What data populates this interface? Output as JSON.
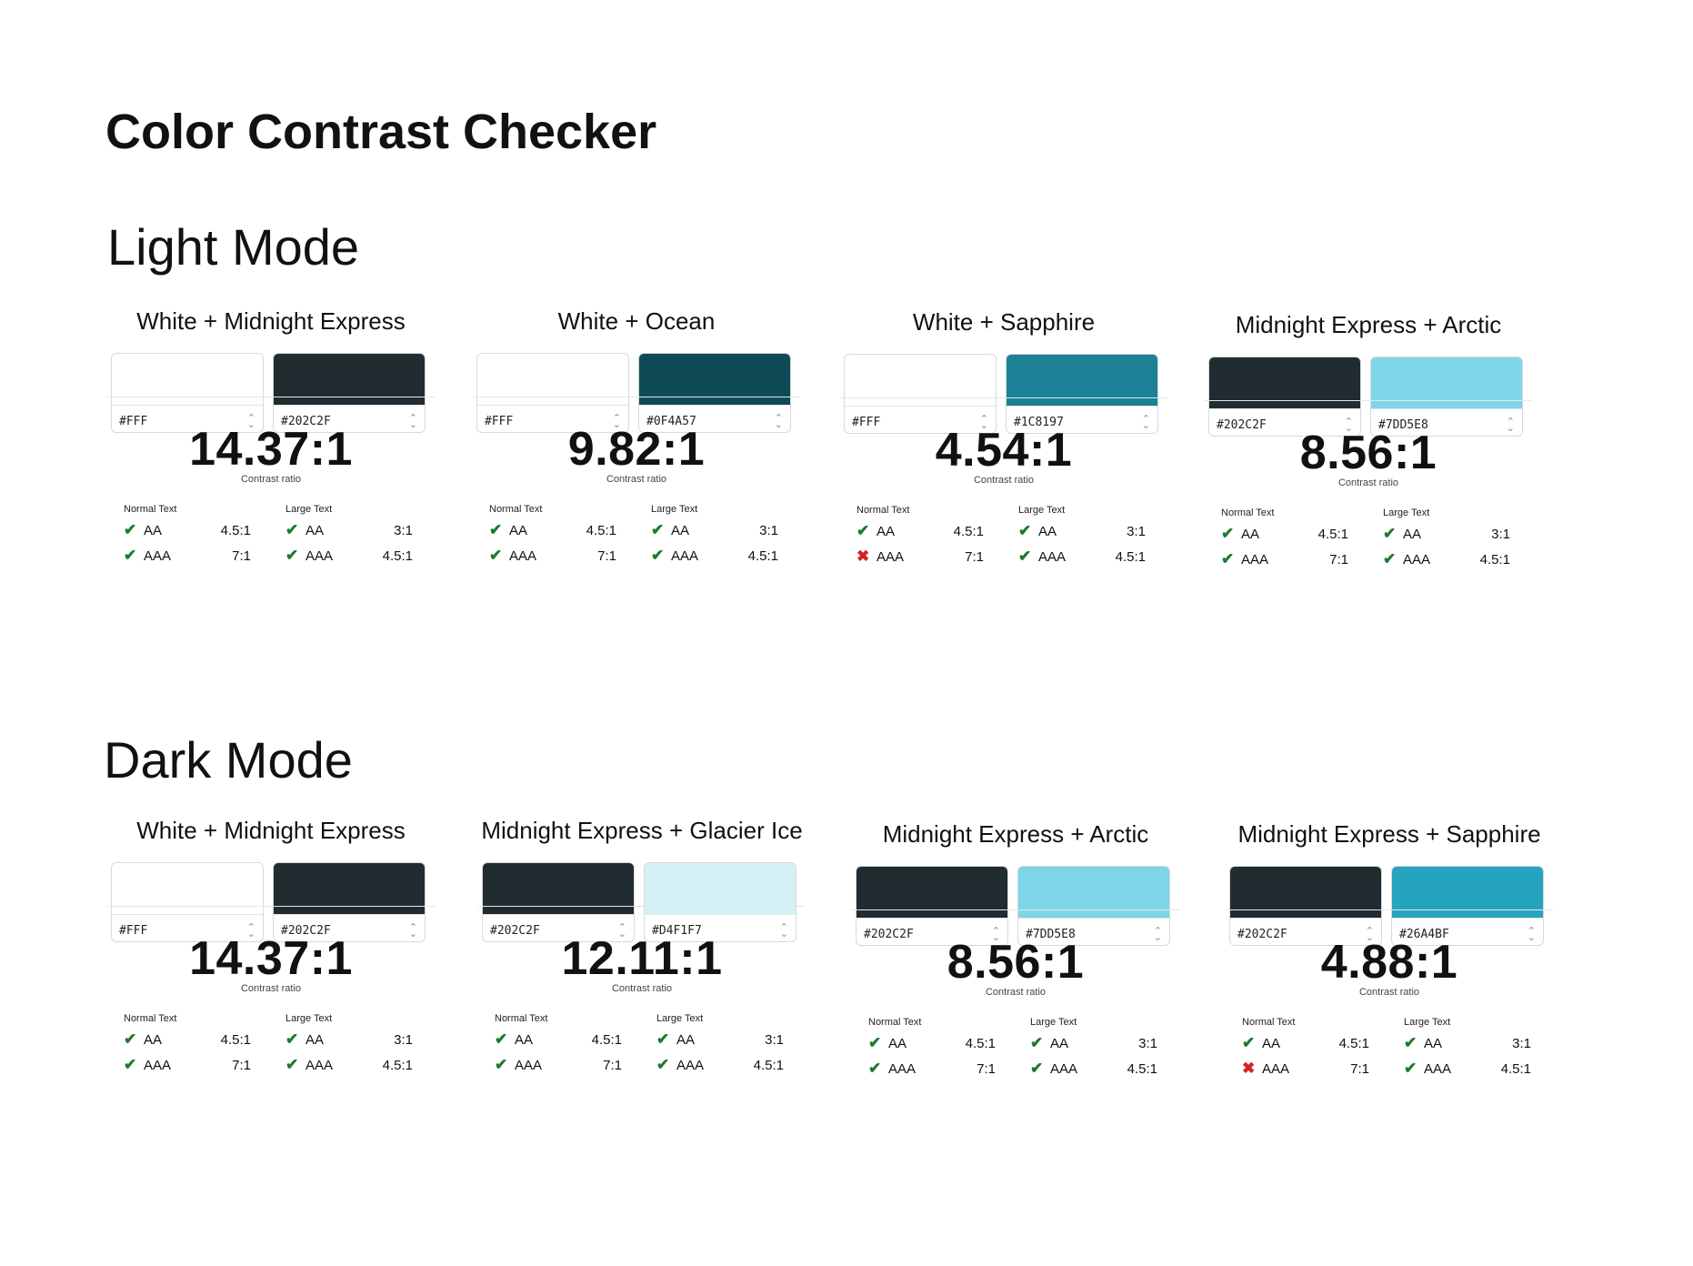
{
  "page_title": "Color Contrast Checker",
  "colors": {
    "pass": "#1e7a2c",
    "fail": "#d32121"
  },
  "labels": {
    "contrast_ratio": "Contrast ratio",
    "normal_text": "Normal Text",
    "large_text": "Large Text"
  },
  "sections": [
    {
      "title": "Light Mode",
      "cards": [
        {
          "title": "White + Midnight Express",
          "bg_color": "#FFFFFF",
          "fg_color": "#202C2F",
          "bg_hex": "#FFF",
          "fg_hex": "#202C2F",
          "ratio": "14.37:1",
          "normal": [
            {
              "level": "AA",
              "req": "4.5:1",
              "pass": true
            },
            {
              "level": "AAA",
              "req": "7:1",
              "pass": true
            }
          ],
          "large": [
            {
              "level": "AA",
              "req": "3:1",
              "pass": true
            },
            {
              "level": "AAA",
              "req": "4.5:1",
              "pass": true
            }
          ]
        },
        {
          "title": "White + Ocean",
          "bg_color": "#FFFFFF",
          "fg_color": "#0F4A57",
          "bg_hex": "#FFF",
          "fg_hex": "#0F4A57",
          "ratio": "9.82:1",
          "normal": [
            {
              "level": "AA",
              "req": "4.5:1",
              "pass": true
            },
            {
              "level": "AAA",
              "req": "7:1",
              "pass": true
            }
          ],
          "large": [
            {
              "level": "AA",
              "req": "3:1",
              "pass": true
            },
            {
              "level": "AAA",
              "req": "4.5:1",
              "pass": true
            }
          ]
        },
        {
          "title": "White + Sapphire",
          "bg_color": "#FFFFFF",
          "fg_color": "#1C8197",
          "bg_hex": "#FFF",
          "fg_hex": "#1C8197",
          "ratio": "4.54:1",
          "normal": [
            {
              "level": "AA",
              "req": "4.5:1",
              "pass": true
            },
            {
              "level": "AAA",
              "req": "7:1",
              "pass": false
            }
          ],
          "large": [
            {
              "level": "AA",
              "req": "3:1",
              "pass": true
            },
            {
              "level": "AAA",
              "req": "4.5:1",
              "pass": true
            }
          ]
        },
        {
          "title": "Midnight Express  + Arctic",
          "bg_color": "#202C2F",
          "fg_color": "#7DD5E8",
          "bg_hex": "#202C2F",
          "fg_hex": "#7DD5E8",
          "ratio": "8.56:1",
          "normal": [
            {
              "level": "AA",
              "req": "4.5:1",
              "pass": true
            },
            {
              "level": "AAA",
              "req": "7:1",
              "pass": true
            }
          ],
          "large": [
            {
              "level": "AA",
              "req": "3:1",
              "pass": true
            },
            {
              "level": "AAA",
              "req": "4.5:1",
              "pass": true
            }
          ]
        }
      ]
    },
    {
      "title": "Dark Mode",
      "cards": [
        {
          "title": "White + Midnight Express",
          "bg_color": "#FFFFFF",
          "fg_color": "#202C2F",
          "bg_hex": "#FFF",
          "fg_hex": "#202C2F",
          "ratio": "14.37:1",
          "normal": [
            {
              "level": "AA",
              "req": "4.5:1",
              "pass": true
            },
            {
              "level": "AAA",
              "req": "7:1",
              "pass": true
            }
          ],
          "large": [
            {
              "level": "AA",
              "req": "3:1",
              "pass": true
            },
            {
              "level": "AAA",
              "req": "4.5:1",
              "pass": true
            }
          ]
        },
        {
          "title": "Midnight Express + Glacier Ice",
          "bg_color": "#202C2F",
          "fg_color": "#D4F1F7",
          "bg_hex": "#202C2F",
          "fg_hex": "#D4F1F7",
          "ratio": "12.11:1",
          "normal": [
            {
              "level": "AA",
              "req": "4.5:1",
              "pass": true
            },
            {
              "level": "AAA",
              "req": "7:1",
              "pass": true
            }
          ],
          "large": [
            {
              "level": "AA",
              "req": "3:1",
              "pass": true
            },
            {
              "level": "AAA",
              "req": "4.5:1",
              "pass": true
            }
          ]
        },
        {
          "title": "Midnight Express  + Arctic",
          "bg_color": "#202C2F",
          "fg_color": "#7DD5E8",
          "bg_hex": "#202C2F",
          "fg_hex": "#7DD5E8",
          "ratio": "8.56:1",
          "normal": [
            {
              "level": "AA",
              "req": "4.5:1",
              "pass": true
            },
            {
              "level": "AAA",
              "req": "7:1",
              "pass": true
            }
          ],
          "large": [
            {
              "level": "AA",
              "req": "3:1",
              "pass": true
            },
            {
              "level": "AAA",
              "req": "4.5:1",
              "pass": true
            }
          ]
        },
        {
          "title": "Midnight Express  + Sapphire",
          "bg_color": "#202C2F",
          "fg_color": "#26A4BF",
          "bg_hex": "#202C2F",
          "fg_hex": "#26A4BF",
          "ratio": "4.88:1",
          "normal": [
            {
              "level": "AA",
              "req": "4.5:1",
              "pass": true
            },
            {
              "level": "AAA",
              "req": "7:1",
              "pass": false
            }
          ],
          "large": [
            {
              "level": "AA",
              "req": "3:1",
              "pass": true
            },
            {
              "level": "AAA",
              "req": "4.5:1",
              "pass": true
            }
          ]
        }
      ]
    }
  ]
}
